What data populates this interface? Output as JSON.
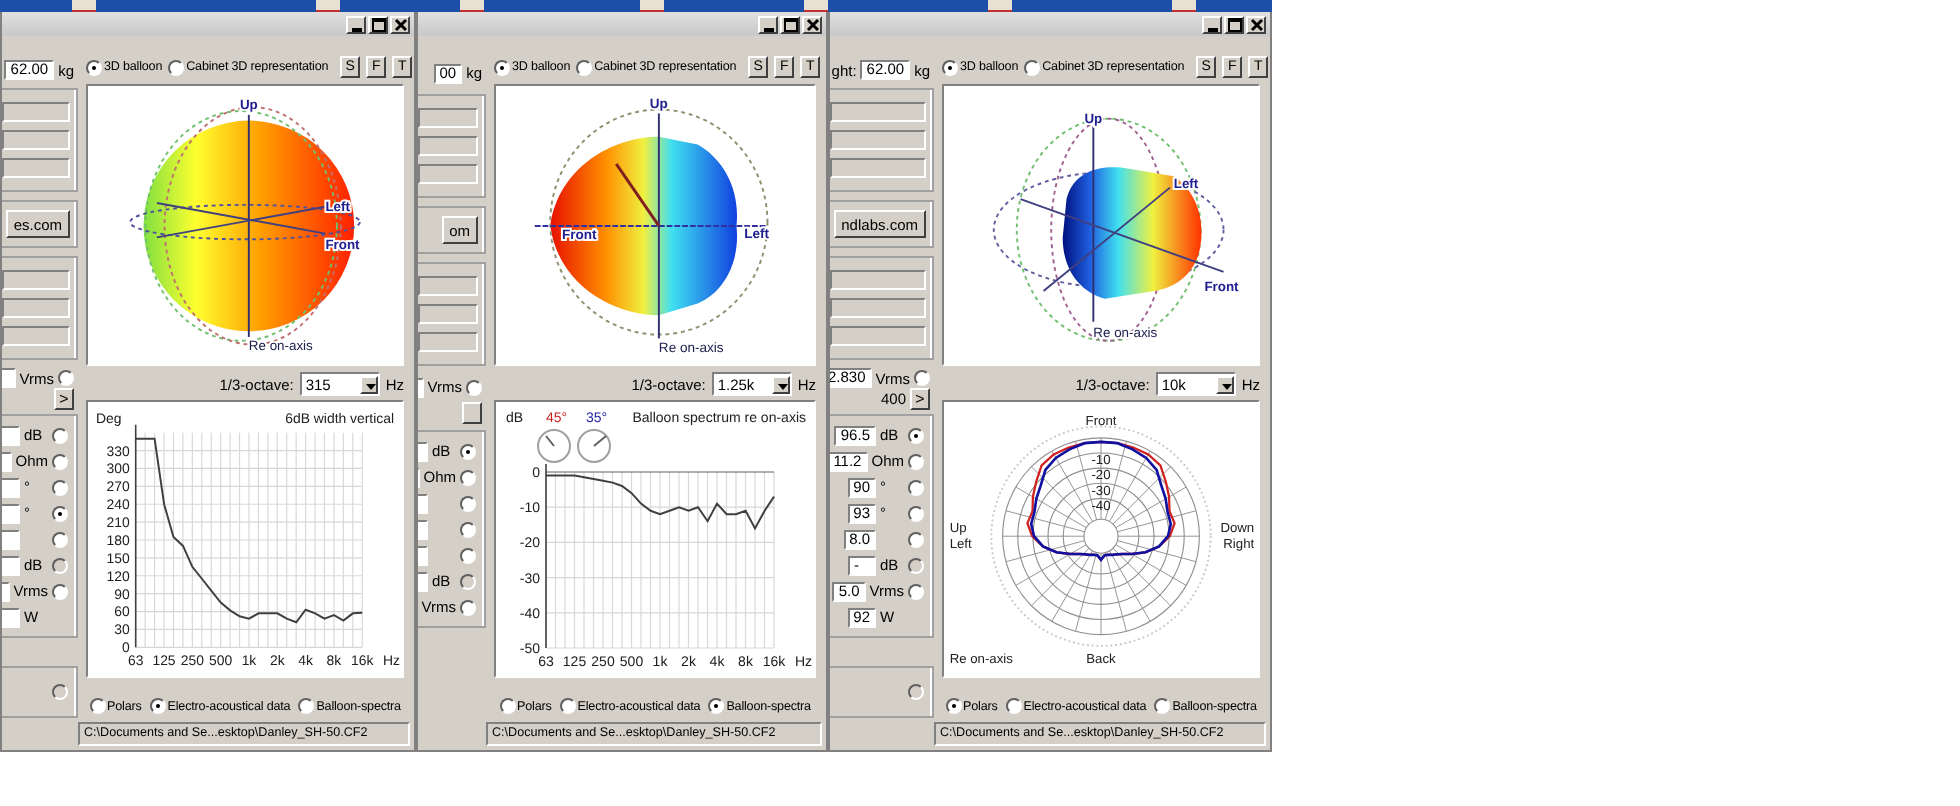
{
  "windows": [
    {
      "left_top": [
        {
          "kind": "field",
          "value": "62.00",
          "unit": "kg"
        },
        {
          "kind": "group"
        },
        {
          "kind": "button",
          "text": "es.com"
        },
        {
          "kind": "group"
        },
        {
          "kind": "radio_field",
          "unit": "Vrms",
          "selected": false
        },
        {
          "kind": "nav",
          "text": ">"
        }
      ],
      "left_rows": [
        {
          "kind": "radio_row",
          "unit": "dB",
          "selected": false,
          "disabled": false
        },
        {
          "kind": "radio_row",
          "unit": "Ohm",
          "selected": false,
          "disabled": false
        },
        {
          "kind": "radio_row",
          "unit": "°",
          "selected": false,
          "disabled": false
        },
        {
          "kind": "radio_row",
          "unit": "°",
          "selected": true,
          "disabled": false
        },
        {
          "kind": "radio_row",
          "selected": false,
          "disabled": false
        },
        {
          "kind": "radio_row",
          "unit": "dB",
          "selected": false,
          "disabled": true
        },
        {
          "kind": "radio_row",
          "unit": "Vrms",
          "selected": false,
          "disabled": false
        },
        {
          "kind": "plain_row",
          "unit": "W"
        }
      ],
      "bottom_option": {
        "disabled": true
      },
      "view_options": [
        {
          "label": "3D balloon",
          "selected": true
        },
        {
          "label": "Cabinet 3D representation",
          "selected": false
        }
      ],
      "view_buttons": [
        "S",
        "F",
        "T"
      ],
      "balloon": {
        "kind": "sphere",
        "up": "Up",
        "left": "Left",
        "front": "Front",
        "reference": "Re on-axis"
      },
      "octave": {
        "label": "1/3-octave:",
        "value": "315",
        "unit": "Hz"
      },
      "bottom": {
        "kind": "line_chart",
        "chart_data": {
          "type": "line",
          "grid": true,
          "ylabel": "Deg",
          "xlabel": "Hz",
          "categories": [
            "63",
            null,
            null,
            "125",
            null,
            null,
            "250",
            null,
            null,
            "500",
            null,
            null,
            "1k",
            null,
            null,
            "2k",
            null,
            null,
            "4k",
            null,
            null,
            "8k",
            null,
            null,
            "16k"
          ],
          "series": [
            {
              "name": "6dB width vertical",
              "color": "#404040",
              "values": [
                350,
                350,
                350,
                240,
                185,
                170,
                135,
                115,
                95,
                75,
                62,
                52,
                48,
                57,
                57,
                57,
                48,
                42,
                63,
                57,
                48,
                54,
                45,
                57,
                58
              ]
            }
          ],
          "ylim": [
            0,
            360
          ],
          "yticks": [
            0,
            30,
            60,
            90,
            120,
            150,
            180,
            210,
            240,
            270,
            300,
            330
          ]
        }
      },
      "plot_modes": [
        {
          "label": "Polars",
          "selected": false
        },
        {
          "label": "Electro-acoustical data",
          "selected": true
        },
        {
          "label": "Balloon-spectra",
          "selected": false
        }
      ],
      "status": "C:\\Documents and Se...esktop\\Danley_SH-50.CF2"
    },
    {
      "left_top": [
        {
          "kind": "field",
          "value": "00",
          "unit": "kg"
        },
        {
          "kind": "group"
        },
        {
          "kind": "button",
          "text": "om"
        },
        {
          "kind": "group"
        },
        {
          "kind": "radio_field",
          "unit": "Vrms",
          "selected": false
        },
        {
          "kind": "nav"
        }
      ],
      "left_rows": [
        {
          "kind": "radio_row",
          "unit": "dB",
          "selected": true,
          "disabled": false
        },
        {
          "kind": "radio_row",
          "unit": "Ohm",
          "selected": false,
          "disabled": false
        },
        {
          "kind": "radio_row",
          "selected": false,
          "disabled": false
        },
        {
          "kind": "radio_row",
          "selected": false,
          "disabled": false
        },
        {
          "kind": "radio_row",
          "selected": false,
          "disabled": false
        },
        {
          "kind": "radio_row",
          "unit": "dB",
          "selected": false,
          "disabled": true
        },
        {
          "kind": "radio_row",
          "unit": "Vrms",
          "selected": false,
          "disabled": false
        }
      ],
      "view_options": [
        {
          "label": "3D balloon",
          "selected": true
        },
        {
          "label": "Cabinet 3D representation",
          "selected": false
        }
      ],
      "view_buttons": [
        "S",
        "F",
        "T"
      ],
      "balloon": {
        "kind": "lens",
        "up": "Up",
        "left": "Left",
        "front": "Front",
        "reference": "Re on-axis"
      },
      "octave": {
        "label": "1/3-octave:",
        "value": "1.25k",
        "unit": "Hz"
      },
      "bottom": {
        "kind": "line_chart",
        "gauges": [
          {
            "text": "45°",
            "color": "#cc2222"
          },
          {
            "text": "35°",
            "color": "#2222aa"
          }
        ],
        "chart_data": {
          "type": "line",
          "grid": true,
          "ylabel": "dB",
          "xlabel": "Hz",
          "categories": [
            "63",
            null,
            null,
            "125",
            null,
            null,
            "250",
            null,
            null,
            "500",
            null,
            null,
            "1k",
            null,
            null,
            "2k",
            null,
            null,
            "4k",
            null,
            null,
            "8k",
            null,
            null,
            "16k"
          ],
          "series": [
            {
              "name": "Balloon spectrum re on-axis",
              "color": "#404040",
              "values": [
                -1,
                -1,
                -1,
                -1,
                -1.5,
                -2,
                -2.5,
                -3,
                -4,
                -6,
                -9,
                -11,
                -12,
                -11,
                -10,
                -11,
                -10,
                -14,
                -9,
                -12,
                -12,
                -11,
                -16,
                -11,
                -7
              ]
            }
          ],
          "ylim": [
            -50,
            0
          ],
          "yticks": [
            0,
            -10,
            -20,
            -30,
            -40,
            -50
          ]
        }
      },
      "plot_modes": [
        {
          "label": "Polars",
          "selected": false
        },
        {
          "label": "Electro-acoustical data",
          "selected": false
        },
        {
          "label": "Balloon-spectra",
          "selected": true
        }
      ],
      "status": "C:\\Documents and Se...esktop\\Danley_SH-50.CF2"
    },
    {
      "left_top": [
        {
          "kind": "field",
          "label": "ght:",
          "value": "62.00",
          "unit": "kg"
        },
        {
          "kind": "group"
        },
        {
          "kind": "button",
          "text": "ndlabs.com"
        },
        {
          "kind": "group"
        },
        {
          "kind": "radio_field",
          "value": "2.830",
          "unit": "Vrms",
          "selected": false
        },
        {
          "kind": "nav",
          "value": "400",
          "text": ">"
        }
      ],
      "left_rows": [
        {
          "kind": "radio_row",
          "value": "96.5",
          "unit": "dB",
          "selected": true,
          "disabled": false
        },
        {
          "kind": "radio_row",
          "value": "11.2",
          "unit": "Ohm",
          "selected": false,
          "disabled": false
        },
        {
          "kind": "radio_row",
          "value": "90",
          "unit": "°",
          "selected": false,
          "disabled": false
        },
        {
          "kind": "radio_row",
          "value": "93",
          "unit": "°",
          "selected": false,
          "disabled": false
        },
        {
          "kind": "radio_row",
          "value": "8.0",
          "selected": false,
          "disabled": false
        },
        {
          "kind": "radio_row",
          "value": "-",
          "unit": "dB",
          "selected": false,
          "disabled": true
        },
        {
          "kind": "radio_row",
          "value": "5.0",
          "unit": "Vrms",
          "selected": false,
          "disabled": false
        },
        {
          "kind": "plain_row",
          "value": "92",
          "unit": "W"
        }
      ],
      "bottom_option": {
        "disabled": true
      },
      "view_options": [
        {
          "label": "3D balloon",
          "selected": true
        },
        {
          "label": "Cabinet 3D representation",
          "selected": false
        }
      ],
      "view_buttons": [
        "S",
        "F",
        "T"
      ],
      "balloon": {
        "kind": "blob",
        "up": "Up",
        "left": "Left",
        "front": "Front",
        "reference": "Re on-axis"
      },
      "octave": {
        "label": "1/3-octave:",
        "value": "10k",
        "unit": "Hz"
      },
      "bottom": {
        "kind": "polar",
        "front": "Front",
        "back": "Back",
        "left_top": "Up",
        "left_bottom": "Left",
        "right_top": "Down",
        "right_bottom": "Right",
        "reference": "Re on-axis",
        "ring_labels": [
          "-10",
          "-20",
          "-30",
          "-40"
        ]
      },
      "plot_modes": [
        {
          "label": "Polars",
          "selected": true
        },
        {
          "label": "Electro-acoustical data",
          "selected": false
        },
        {
          "label": "Balloon-spectra",
          "selected": false
        }
      ],
      "status": "C:\\Documents and Se...esktop\\Danley_SH-50.CF2"
    }
  ]
}
